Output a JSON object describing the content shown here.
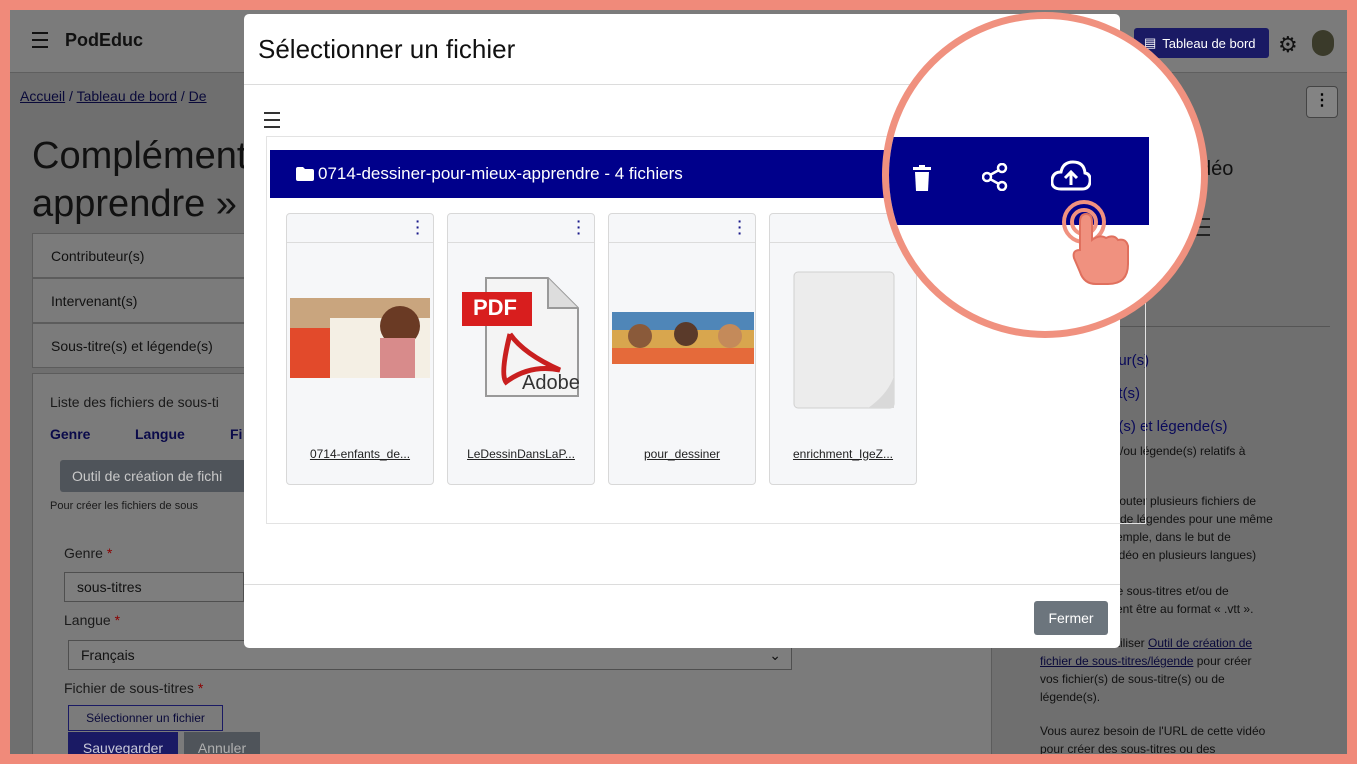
{
  "app": {
    "brand": "PodEduc",
    "dashboard_button": "Tableau de bord"
  },
  "breadcrumb": {
    "home": "Accueil",
    "sep1": " / ",
    "dashboard": "Tableau de bord",
    "sep2": " / ",
    "current": "De"
  },
  "page": {
    "title_line1": "Complément",
    "title_line2": "apprendre »"
  },
  "accordion": {
    "contributors": "Contributeur(s)",
    "speakers": "Intervenant(s)",
    "subtitles": "Sous-titre(s) et légende(s)"
  },
  "form": {
    "list_label": "Liste des fichiers de sous-ti",
    "col_kind": "Genre",
    "col_lang": "Langue",
    "col_file": "Fi",
    "tool_button": "Outil de création de fichi",
    "tool_help": "Pour créer les fichiers de sous",
    "kind_label": "Genre",
    "kind_value": "sous-titres",
    "lang_label": "Langue",
    "lang_value": "Français",
    "file_label": "Fichier de sous-titres",
    "required": "*",
    "select_file_button": "Sélectionner un fichier",
    "save_button": "Sauvegarder",
    "cancel_button": "Annuler"
  },
  "sidebar": {
    "video": "déo",
    "link1": "eur(s)",
    "link2": "nt(s)",
    "link3": "e(s) et légende(s)",
    "text1": "et/ou légende(s) relatifs à",
    "text2a": "ajouter plusieurs fichiers de",
    "text2b": "u de légendes pour une même",
    "text2c": "xemple, dans le but de",
    "text2d": "vidéo en plusieurs langues)",
    "text3a": "de sous-titres et/ou de",
    "text3b": "vent être au format « .vtt ».",
    "text4_prefix": "utiliser ",
    "text4_link_a": "Outil de création de",
    "text4_link_b": "fichier de sous-titres/légende",
    "text4_suffix": " pour créer",
    "text4b": "vos fichier(s) de sous-titre(s) ou de",
    "text4c": "légende(s).",
    "text5a": "Vous aurez besoin de l'URL de cette vidéo",
    "text5b": "pour créer des sous-titres ou des"
  },
  "modal": {
    "title": "Sélectionner un fichier",
    "folder_label": "0714-dessiner-pour-mieux-apprendre - 4 fichiers",
    "files": [
      {
        "name": "0714-enfants_de..."
      },
      {
        "name": "LeDessinDansLaP...",
        "badge": "PDF",
        "logo": "Adobe"
      },
      {
        "name": "pour_dessiner"
      },
      {
        "name": "enrichment_IgeZ..."
      }
    ],
    "close_button": "Fermer"
  },
  "icons": {
    "folder": "folder-icon",
    "trash": "trash-icon",
    "share": "share-icon",
    "upload": "cloud-upload-icon",
    "hand": "hand-pointer-icon"
  },
  "colors": {
    "accent": "#00008b",
    "highlight_ring": "#f0917f",
    "close_button": "#6c757d"
  }
}
